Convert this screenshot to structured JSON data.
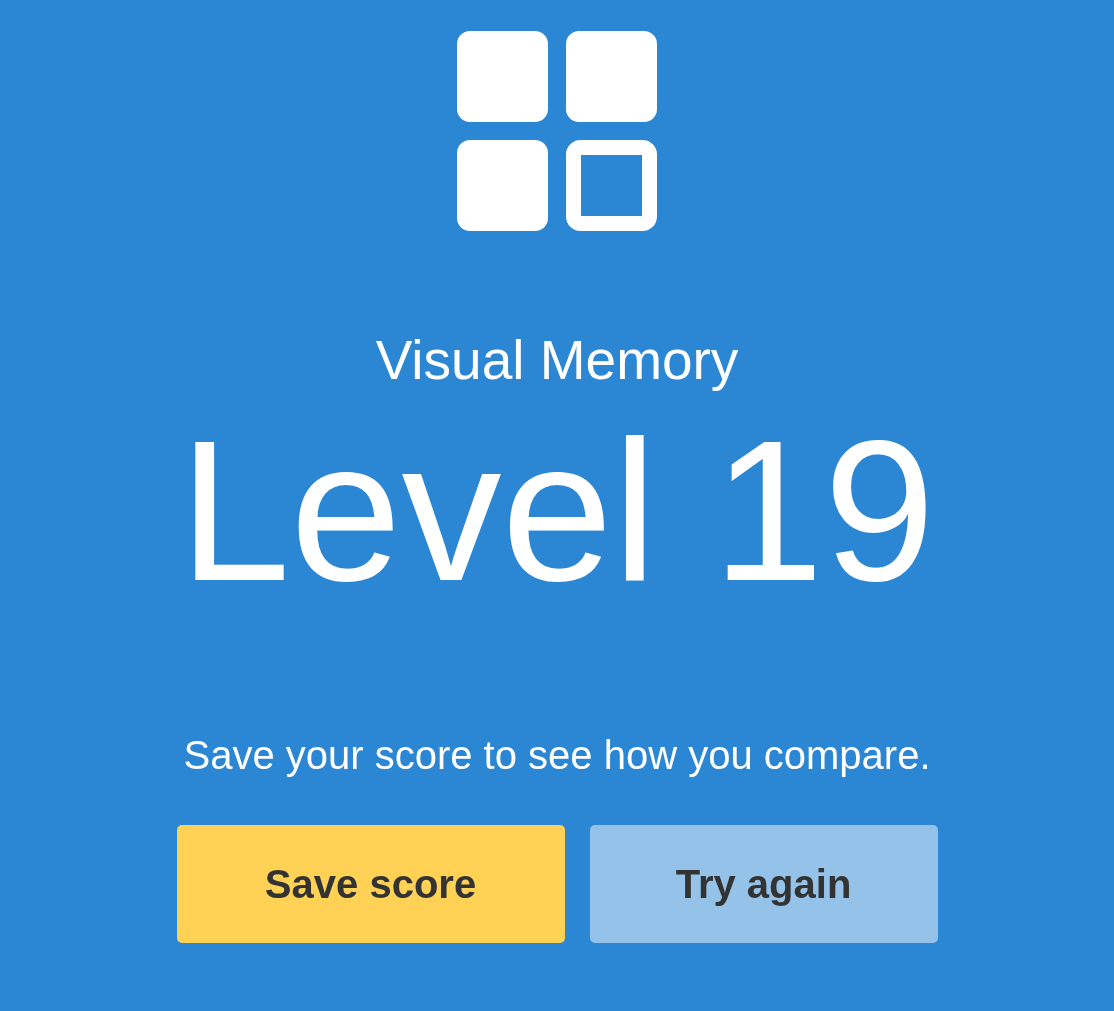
{
  "title": "Visual Memory",
  "result": "Level 19",
  "message": "Save your score to see how you compare.",
  "buttons": [
    {
      "label": "Save score",
      "kind": "primary"
    },
    {
      "label": "Try again",
      "kind": "secondary"
    }
  ]
}
